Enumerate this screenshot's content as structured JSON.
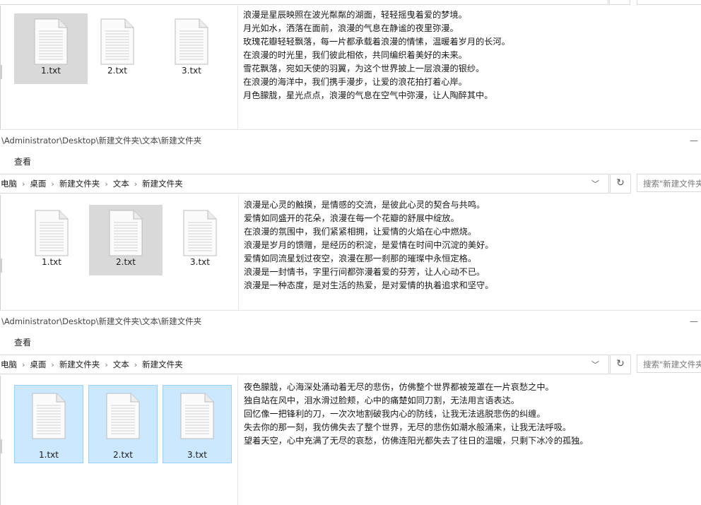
{
  "windows": [
    {
      "files": [
        {
          "name": "1.txt",
          "state": "selected-gray"
        },
        {
          "name": "2.txt",
          "state": "normal"
        },
        {
          "name": "3.txt",
          "state": "normal"
        }
      ],
      "preview_lines": [
        "浪漫是星辰映照在波光粼粼的湖面，轻轻摇曳着爱的梦境。",
        "月光如水，洒落在面前，浪漫的气息在静谧的夜里弥漫。",
        "玫瑰花瓣轻轻飘落，每一片都承载着浪漫的情愫，温暖着岁月的长河。",
        "在浪漫的时光里，我们彼此相依，共同编织着美好的未来。",
        "雪花飘落，宛如天使的羽翼，为这个世界披上一层浪漫的银纱。",
        "在浪漫的海洋中，我们携手漫步，让爱的浪花拍打着心岸。",
        "月色朦胧，星光点点，浪漫的气息在空气中弥漫，让人陶醉其中。"
      ]
    },
    {
      "title": "\\Administrator\\Desktop\\新建文件夹\\文本\\新建文件夹",
      "minimize": "—",
      "ribbon_tab": "查看",
      "breadcrumb": [
        "此电脑",
        "桌面",
        "新建文件夹",
        "文本",
        "新建文件夹"
      ],
      "breadcrumb_display": [
        "电脑",
        "桌面",
        "新建文件夹",
        "文本",
        "新建文件夹"
      ],
      "search_placeholder": "搜索\"新建文件夹\"",
      "files": [
        {
          "name": "1.txt",
          "state": "normal"
        },
        {
          "name": "2.txt",
          "state": "selected-gray"
        },
        {
          "name": "3.txt",
          "state": "normal"
        }
      ],
      "preview_lines": [
        "浪漫是心灵的触摸，是情感的交流，是彼此心灵的契合与共鸣。",
        "爱情如同盛开的花朵，浪漫在每一个花瓣的舒展中绽放。",
        "在浪漫的氛围中，我们紧紧相拥，让爱情的火焰在心中燃烧。",
        "浪漫是岁月的馈赠，是经历的积淀，是爱情在时间中沉淀的美好。",
        "爱情如同流星划过夜空，浪漫在那一刹那的璀璨中永恒定格。",
        "浪漫是一封情书，字里行间都弥漫着爱的芬芳，让人心动不已。",
        "浪漫是一种态度，是对生活的热爱，是对爱情的执着追求和坚守。"
      ]
    },
    {
      "title": "\\Administrator\\Desktop\\新建文件夹\\文本\\新建文件夹",
      "minimize": "—",
      "ribbon_tab": "查看",
      "breadcrumb_display": [
        "电脑",
        "桌面",
        "新建文件夹",
        "文本",
        "新建文件夹"
      ],
      "search_placeholder": "搜索\"新建文件夹\"",
      "files": [
        {
          "name": "1.txt",
          "state": "selected-blue"
        },
        {
          "name": "2.txt",
          "state": "selected-blue"
        },
        {
          "name": "3.txt",
          "state": "selected-blue"
        }
      ],
      "preview_lines": [
        "夜色朦胧，心海深处涌动着无尽的悲伤，仿佛整个世界都被笼罩在一片哀愁之中。",
        "独自站在风中，泪水滑过脸颊，心中的痛楚如同刀割，无法用言语表达。",
        "回忆像一把锋利的刀，一次次地割破我内心的防线，让我无法逃脱悲伤的纠缠。",
        "失去你的那一刻，我仿佛失去了整个世界，无尽的悲伤如潮水般涌来，让我无法呼吸。",
        "望着天空，心中充满了无尽的哀愁，仿佛连阳光都失去了往日的温暖，只剩下冰冷的孤独。"
      ]
    }
  ]
}
